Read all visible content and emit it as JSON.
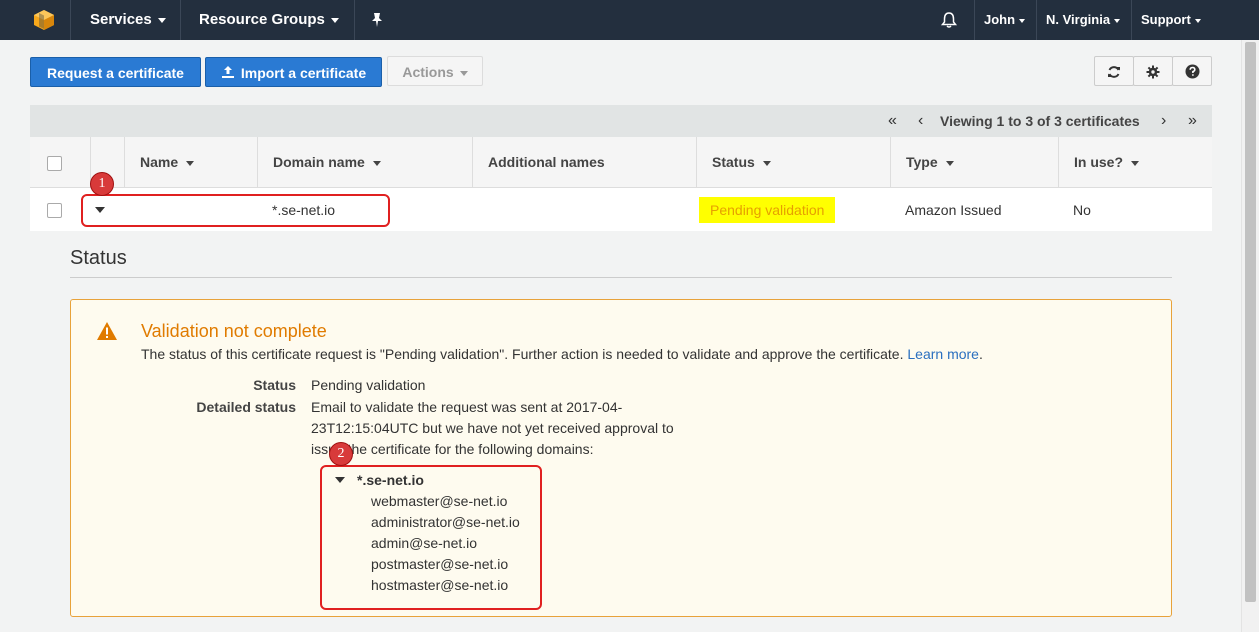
{
  "topnav": {
    "services": "Services",
    "resource_groups": "Resource Groups",
    "user": "John",
    "region": "N. Virginia",
    "support": "Support"
  },
  "toolbar": {
    "request_label": "Request a certificate",
    "import_label": "Import a certificate",
    "actions_label": "Actions"
  },
  "pager": {
    "viewing": "Viewing 1 to 3 of 3 certificates",
    "first": "«",
    "prev": "‹",
    "next": "›",
    "last": "»"
  },
  "table": {
    "columns": [
      "Name",
      "Domain name",
      "Additional names",
      "Status",
      "Type",
      "In use?"
    ],
    "rows": [
      {
        "name": "",
        "domain": "*.se-net.io",
        "additional": "",
        "status": "Pending validation",
        "type": "Amazon Issued",
        "in_use": "No"
      }
    ]
  },
  "detail": {
    "heading": "Status",
    "warning_title": "Validation not complete",
    "warning_text": "The status of this certificate request is \"Pending validation\". Further action is needed to validate and approve the certificate.",
    "learn_more": "Learn more",
    "learn_more_tail": ".",
    "status_label": "Status",
    "status_value": "Pending validation",
    "detailed_label": "Detailed status",
    "detailed_line1": "Email to validate the request was sent at 2017-04-",
    "detailed_line2": "23T12:15:04UTC but we have not yet received approval to",
    "detailed_line3": "issue the certificate for the following domains:",
    "domain": "*.se-net.io",
    "emails": [
      "webmaster@se-net.io",
      "administrator@se-net.io",
      "admin@se-net.io",
      "postmaster@se-net.io",
      "hostmaster@se-net.io"
    ]
  },
  "annotations": {
    "one": "1",
    "two": "2"
  },
  "colors": {
    "nav_bg": "#232f3e",
    "primary": "#2a7ad3",
    "warning": "#e07b00",
    "highlight": "#ffff00",
    "annotation": "#e02020"
  },
  "icons": [
    "aws-cube-icon",
    "chevron-down-icon",
    "pin-icon",
    "bell-icon",
    "upload-icon",
    "refresh-icon",
    "gear-icon",
    "help-icon",
    "warning-icon",
    "caret-down-icon"
  ]
}
